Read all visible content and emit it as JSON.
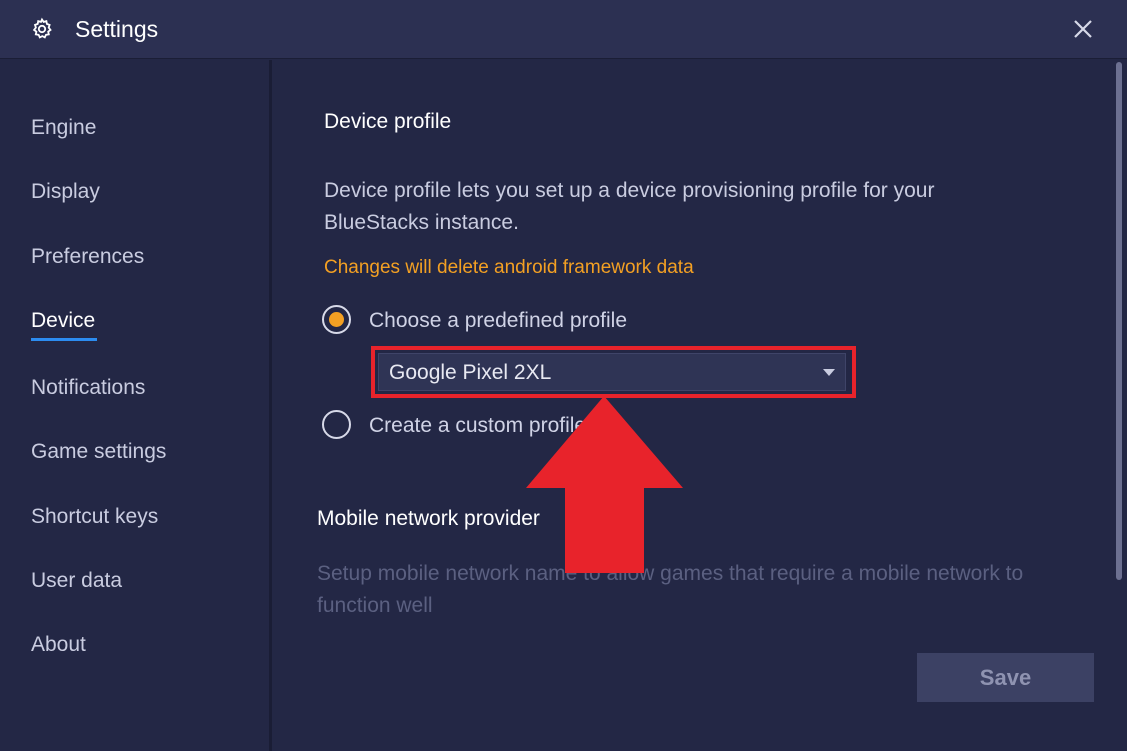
{
  "window": {
    "title": "Settings",
    "icon": "gear-icon",
    "close_icon": "close-icon"
  },
  "sidebar": {
    "items": [
      {
        "label": "Engine"
      },
      {
        "label": "Display"
      },
      {
        "label": "Preferences"
      },
      {
        "label": "Device",
        "active": true
      },
      {
        "label": "Notifications"
      },
      {
        "label": "Game settings"
      },
      {
        "label": "Shortcut keys"
      },
      {
        "label": "User data"
      },
      {
        "label": "About"
      }
    ]
  },
  "device_profile": {
    "title": "Device profile",
    "description": "Device profile lets you set up a device provisioning profile for your BlueStacks instance.",
    "warning": "Changes will delete android framework data",
    "option_predefined": "Choose a predefined profile",
    "option_custom": "Create a custom profile",
    "selected_option": "predefined",
    "dropdown_value": "Google Pixel 2XL"
  },
  "mobile_network": {
    "title": "Mobile network provider",
    "description": "Setup mobile network name to allow games that require a mobile network to function well"
  },
  "footer": {
    "save_label": "Save"
  },
  "colors": {
    "background": "#232745",
    "titlebar": "#2c3052",
    "accent_blue": "#2c8cf0",
    "warning_orange": "#f3a023",
    "highlight_red": "#e8232b"
  }
}
